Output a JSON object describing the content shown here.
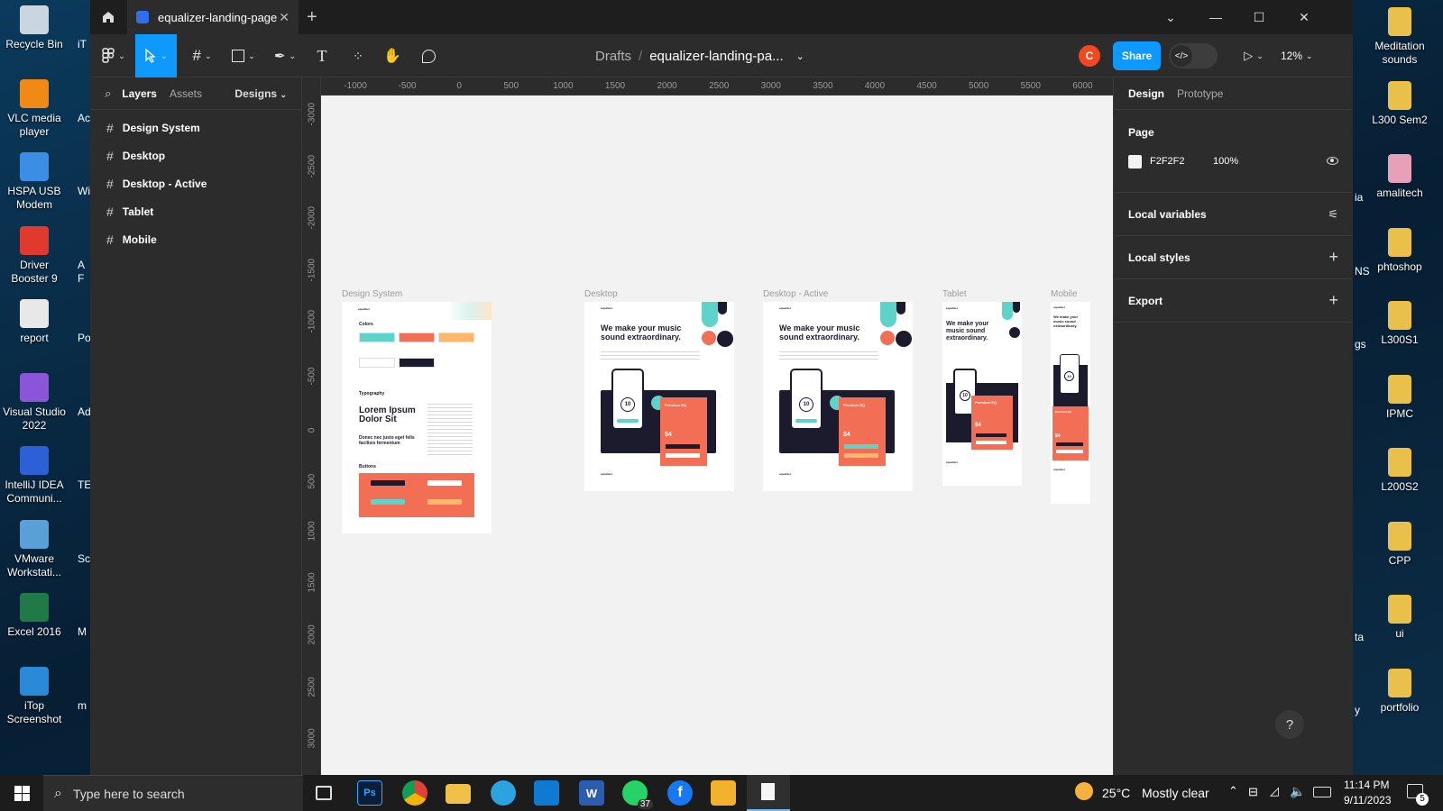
{
  "desktop": {
    "left_icons": [
      {
        "label": "Recycle Bin",
        "icon": "recycle-bin-icon",
        "color": "#c9d6e0"
      },
      {
        "label": "VLC media player",
        "icon": "vlc-icon",
        "color": "#f08a14"
      },
      {
        "label": "HSPA USB Modem",
        "icon": "globe-icon",
        "color": "#3a8ee6"
      },
      {
        "label": "Driver Booster 9",
        "icon": "driver-booster-icon",
        "color": "#e03a2f"
      },
      {
        "label": "report",
        "icon": "pdf-icon",
        "color": "#e8e8e8"
      },
      {
        "label": "Visual Studio 2022",
        "icon": "visual-studio-icon",
        "color": "#8a55d8"
      },
      {
        "label": "IntelliJ IDEA Communi...",
        "icon": "intellij-icon",
        "color": "#2d5fd6"
      },
      {
        "label": "VMware Workstati...",
        "icon": "vmware-icon",
        "color": "#5aa0d8"
      },
      {
        "label": "Excel 2016",
        "icon": "excel-icon",
        "color": "#1f7a45"
      },
      {
        "label": "iTop Screenshot",
        "icon": "itop-screenshot-icon",
        "color": "#2b8ad8"
      }
    ],
    "partial_left": [
      "iT",
      "Ac",
      "Wi",
      "A\nF",
      "Po",
      "Adi",
      "TE",
      "Sc",
      "M",
      "m"
    ],
    "right_icons": [
      {
        "label": "Meditation sounds",
        "icon": "folder-icon",
        "color": "#e8c04a"
      },
      {
        "label": "L300 Sem2",
        "icon": "folder-icon",
        "color": "#e8c04a"
      },
      {
        "label": "amalitech",
        "icon": "folder-icon",
        "color": "#e8a0b8"
      },
      {
        "label": "phtoshop",
        "icon": "folder-icon",
        "color": "#e8c04a"
      },
      {
        "label": "L300S1",
        "icon": "folder-icon",
        "color": "#e8c04a"
      },
      {
        "label": "IPMC",
        "icon": "folder-icon",
        "color": "#e8c04a"
      },
      {
        "label": "L200S2",
        "icon": "folder-icon",
        "color": "#e8c04a"
      },
      {
        "label": "CPP",
        "icon": "folder-icon",
        "color": "#e8c04a"
      },
      {
        "label": "ui",
        "icon": "folder-icon",
        "color": "#e8c04a"
      },
      {
        "label": "portfolio",
        "icon": "folder-icon",
        "color": "#e8c04a"
      }
    ],
    "partial_right": [
      "ia",
      "NS",
      "gs",
      "ta",
      "y"
    ]
  },
  "figma": {
    "tab_title": "equalizer-landing-page",
    "breadcrumb": {
      "drafts": "Drafts",
      "separator": "/",
      "file": "equalizer-landing-pa..."
    },
    "avatar_initial": "C",
    "share_label": "Share",
    "zoom": "12%",
    "left_panel": {
      "tabs": {
        "layers": "Layers",
        "assets": "Assets"
      },
      "pages_dropdown": "Designs",
      "layers": [
        "Design System",
        "Desktop",
        "Desktop - Active",
        "Tablet",
        "Mobile"
      ]
    },
    "ruler_top": [
      "-1000",
      "-500",
      "0",
      "500",
      "1000",
      "1500",
      "2000",
      "2500",
      "3000",
      "3500",
      "4000",
      "4500",
      "5000",
      "5500",
      "6000"
    ],
    "ruler_left": [
      "-3000",
      "-2500",
      "-2000",
      "-1500",
      "-1000",
      "-500",
      "0",
      "500",
      "1000",
      "1500",
      "2000",
      "2500",
      "3000"
    ],
    "frames": {
      "design_system": {
        "label": "Design System",
        "colors_title": "Colors",
        "typography_title": "Typography",
        "headline": "Lorem Ipsum Dolor Sit",
        "subline": "Donec nec justo eget felis facilisis fermentum",
        "buttons_title": "Buttons",
        "swatches": [
          "#5ed3c9",
          "#f26f55",
          "#ffb86b",
          "#ffffff",
          "#1c1b2e"
        ]
      },
      "desktop": {
        "label": "Desktop",
        "headline": "We make your music sound extraordinary.",
        "card_title": "Premium EQ",
        "price": "$4",
        "dial": "10"
      },
      "desktop_active": {
        "label": "Desktop - Active",
        "headline": "We make your music sound extraordinary.",
        "card_title": "Premium EQ",
        "price": "$4",
        "dial": "10"
      },
      "tablet": {
        "label": "Tablet",
        "headline": "We make your music sound extraordinary.",
        "card_title": "Premium EQ",
        "price": "$4",
        "dial": "10"
      },
      "mobile": {
        "label": "Mobile",
        "headline": "We make your music sound extraordinary.",
        "card_title": "Premium EQ",
        "price": "$4",
        "dial": "10"
      },
      "brand": "equalizer"
    },
    "right_panel": {
      "tabs": {
        "design": "Design",
        "prototype": "Prototype"
      },
      "page_title": "Page",
      "page_color": "F2F2F2",
      "page_color_hex": "#f2f2f2",
      "page_opacity": "100%",
      "local_variables": "Local variables",
      "local_styles": "Local styles",
      "export": "Export"
    },
    "help": "?"
  },
  "taskbar": {
    "search_placeholder": "Type here to search",
    "weather_temp": "25°C",
    "weather_text": "Mostly clear",
    "time": "11:14 PM",
    "date": "9/11/2023",
    "whatsapp_badge": "37",
    "notification_count": "5"
  },
  "colors": {
    "accent": "#0d99ff",
    "coral": "#f26f55",
    "teal": "#5ed3c9",
    "navy": "#1c1b2e"
  }
}
